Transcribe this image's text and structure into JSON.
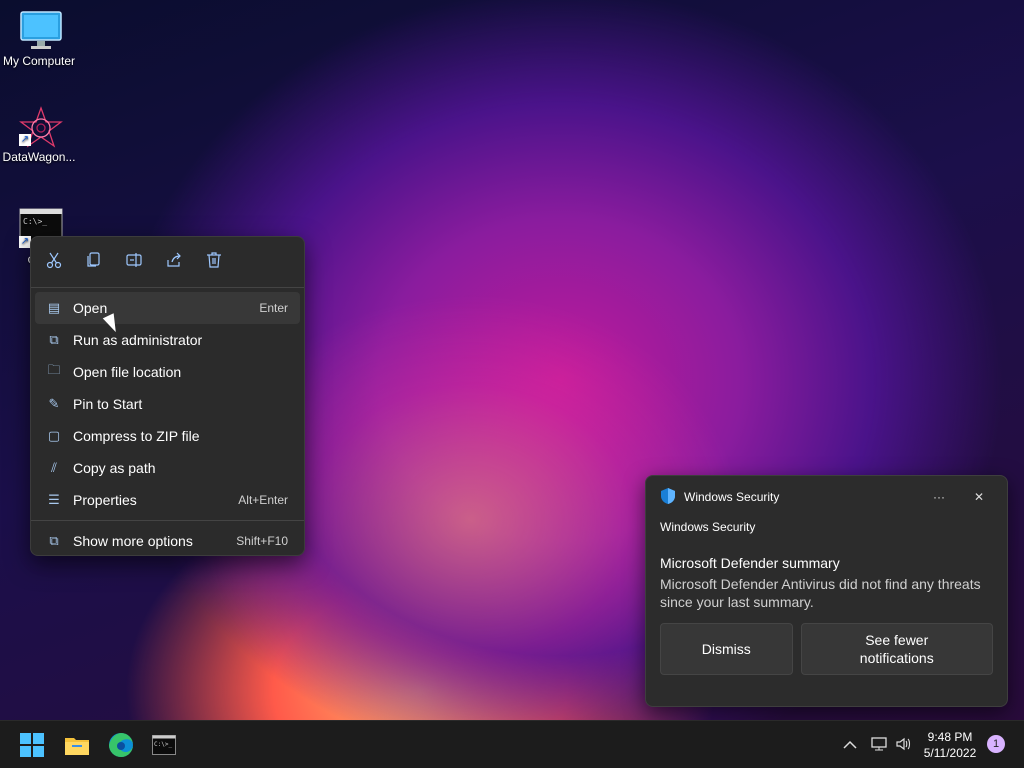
{
  "desktop": {
    "icons": [
      {
        "label": "My Computer",
        "icon": "monitor-icon"
      },
      {
        "label": "DataWagon...",
        "icon": "datawagon-app-icon"
      },
      {
        "label": "cmd",
        "icon": "cmd-icon"
      }
    ]
  },
  "context_menu": {
    "toolbar": [
      {
        "name": "cut",
        "icon": "scissors-icon"
      },
      {
        "name": "copy",
        "icon": "copy-icon"
      },
      {
        "name": "rename",
        "icon": "rename-icon"
      },
      {
        "name": "share",
        "icon": "share-icon"
      },
      {
        "name": "delete",
        "icon": "trash-icon"
      }
    ],
    "items": [
      {
        "label": "Open",
        "shortcut": "Enter",
        "icon": "open-icon"
      },
      {
        "label": "Run as administrator",
        "shortcut": "",
        "icon": "shield-window-icon"
      },
      {
        "label": "Open file location",
        "shortcut": "",
        "icon": "folder-icon"
      },
      {
        "label": "Pin to Start",
        "shortcut": "",
        "icon": "pin-icon"
      },
      {
        "label": "Compress to ZIP file",
        "shortcut": "",
        "icon": "zip-folder-icon"
      },
      {
        "label": "Copy as path",
        "shortcut": "",
        "icon": "path-icon"
      },
      {
        "label": "Properties",
        "shortcut": "Alt+Enter",
        "icon": "properties-icon"
      }
    ],
    "more": {
      "label": "Show more options",
      "shortcut": "Shift+F10",
      "icon": "more-options-icon"
    }
  },
  "notification": {
    "app_name": "Windows Security",
    "subtitle": "Windows Security",
    "heading": "Microsoft Defender summary",
    "body": "Microsoft Defender Antivirus did not find any threats since your last summary.",
    "more_label": "···",
    "close_label": "✕",
    "buttons": {
      "dismiss": "Dismiss",
      "fewer": "See fewer notifications"
    }
  },
  "taskbar": {
    "apps": [
      {
        "name": "start",
        "icon": "windows-logo-icon"
      },
      {
        "name": "file-explorer",
        "icon": "folder-icon"
      },
      {
        "name": "edge",
        "icon": "edge-icon"
      },
      {
        "name": "terminal",
        "icon": "cmd-icon"
      }
    ],
    "clock": {
      "time": "9:48 PM",
      "date": "5/11/2022"
    },
    "notification_count": "1"
  },
  "colors": {
    "accent": "#4cc2ff",
    "menu_bg": "#2b2b2b",
    "taskbar_bg": "#1c1c1c"
  }
}
